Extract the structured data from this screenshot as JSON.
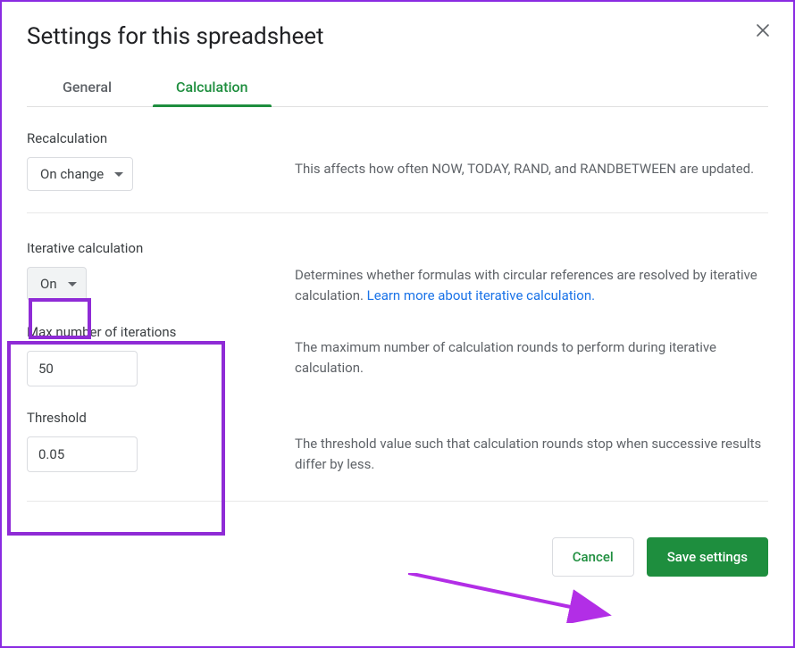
{
  "dialog": {
    "title": "Settings for this spreadsheet"
  },
  "tabs": {
    "general": "General",
    "calculation": "Calculation"
  },
  "recalculation": {
    "label": "Recalculation",
    "select_value": "On change",
    "description": "This affects how often NOW, TODAY, RAND, and RANDBETWEEN are updated."
  },
  "iterative": {
    "label": "Iterative calculation",
    "select_value": "On",
    "description": "Determines whether formulas with circular references are resolved by iterative calculation. ",
    "learn_more": "Learn more about iterative calculation.",
    "max_iter": {
      "label": "Max number of iterations",
      "value": "50",
      "description": "The maximum number of calculation rounds to perform during iterative calculation."
    },
    "threshold": {
      "label": "Threshold",
      "value": "0.05",
      "description": "The threshold value such that calculation rounds stop when successive results differ by less."
    }
  },
  "footer": {
    "cancel": "Cancel",
    "save": "Save settings"
  }
}
